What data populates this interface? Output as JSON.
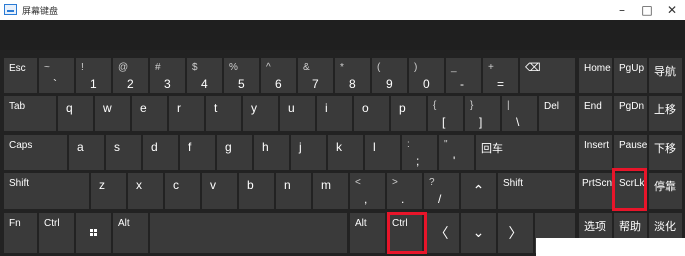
{
  "window": {
    "title": "屏幕键盘"
  },
  "keys": {
    "esc": "Esc",
    "tilde_top": "~",
    "tilde_bot": "`",
    "n1_top": "!",
    "n1_bot": "1",
    "n2_top": "@",
    "n2_bot": "2",
    "n3_top": "#",
    "n3_bot": "3",
    "n4_top": "$",
    "n4_bot": "4",
    "n5_top": "%",
    "n5_bot": "5",
    "n6_top": "^",
    "n6_bot": "6",
    "n7_top": "&",
    "n7_bot": "7",
    "n8_top": "*",
    "n8_bot": "8",
    "n9_top": "(",
    "n9_bot": "9",
    "n0_top": ")",
    "n0_bot": "0",
    "minus_top": "_",
    "minus_bot": "-",
    "equal_top": "+",
    "equal_bot": "=",
    "backspace": "⌫",
    "home": "Home",
    "pgup": "PgUp",
    "nav": "导航",
    "tab": "Tab",
    "q": "q",
    "w": "w",
    "e": "e",
    "r": "r",
    "t": "t",
    "y": "y",
    "u": "u",
    "i": "i",
    "o": "o",
    "p": "p",
    "lbracket_top": "{",
    "lbracket_bot": "[",
    "rbracket_top": "}",
    "rbracket_bot": "]",
    "backslash_top": "|",
    "backslash_bot": "\\",
    "del": "Del",
    "end": "End",
    "pgdn": "PgDn",
    "moveup": "上移",
    "caps": "Caps",
    "a": "a",
    "s": "s",
    "d": "d",
    "f": "f",
    "g": "g",
    "h": "h",
    "j": "j",
    "k": "k",
    "l": "l",
    "semicolon_top": ":",
    "semicolon_bot": ";",
    "quote_top": "\"",
    "quote_bot": "'",
    "enter": "回车",
    "insert": "Insert",
    "pause": "Pause",
    "movedown": "下移",
    "shift": "Shift",
    "z": "z",
    "x": "x",
    "c": "c",
    "v": "v",
    "b": "b",
    "n": "n",
    "m": "m",
    "comma_top": "<",
    "comma_bot": ",",
    "period_top": ">",
    "period_bot": ".",
    "slash_top": "?",
    "slash_bot": "/",
    "up_arrow": "⌃",
    "prtscn": "PrtScn",
    "scrlk": "ScrLk",
    "dock": "停靠",
    "fn": "Fn",
    "ctrl": "Ctrl",
    "alt": "Alt",
    "left_arrow": "〈",
    "down_arrow": "⌄",
    "right_arrow": "〉",
    "options": "选项",
    "help": "帮助",
    "fade": "淡化"
  },
  "colors": {
    "highlight": "#e8152a",
    "key": "#3a3a3a",
    "background": "#222222"
  }
}
